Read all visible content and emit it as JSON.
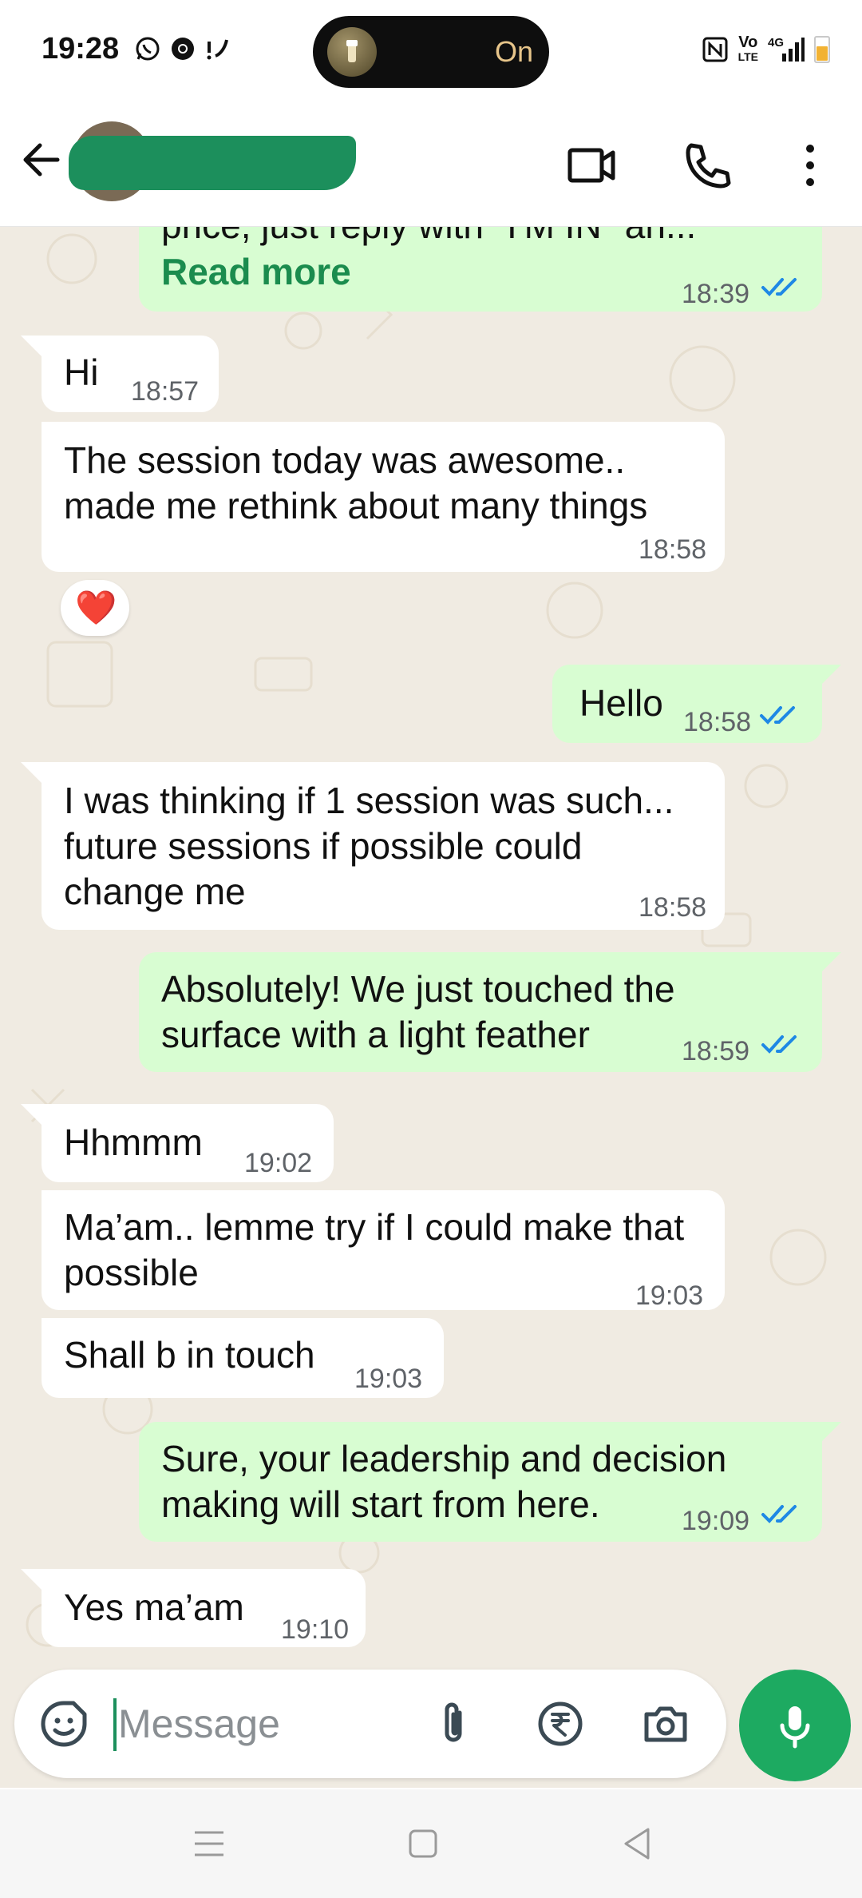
{
  "status_bar": {
    "time": "19:28",
    "island_label": "On",
    "network_volte": "Vo",
    "network_lte": "LTE",
    "network_type": "4G",
    "icons": [
      "whatsapp-icon",
      "chrome-icon",
      "missed-call-icon",
      "nfc-icon",
      "signal-icon",
      "battery-icon"
    ]
  },
  "header": {
    "icons": [
      "back-arrow-icon",
      "video-call-icon",
      "voice-call-icon",
      "more-vert-icon"
    ]
  },
  "messages": [
    {
      "dir": "out",
      "text": "price, just reply with \"I'M IN\" an...",
      "read_more": "Read more",
      "time": "18:39",
      "read": true
    },
    {
      "dir": "in",
      "text": "Hi",
      "time": "18:57"
    },
    {
      "dir": "in",
      "text": "The session today was awesome..\nmade me rethink about many things",
      "time": "18:58",
      "reaction": "❤️"
    },
    {
      "dir": "out",
      "text": "Hello",
      "time": "18:58",
      "read": true
    },
    {
      "dir": "in",
      "text": "I was thinking if 1 session was such...\nfuture sessions if possible could\nchange me",
      "time": "18:58"
    },
    {
      "dir": "out",
      "text": "Absolutely! We just touched the\nsurface with a light feather",
      "time": "18:59",
      "read": true
    },
    {
      "dir": "in",
      "text": "Hhmmm",
      "time": "19:02"
    },
    {
      "dir": "in",
      "text": "Ma’am.. lemme try if I could make that\npossible",
      "time": "19:03"
    },
    {
      "dir": "in",
      "text": "Shall b in touch",
      "time": "19:03"
    },
    {
      "dir": "out",
      "text": "Sure, your leadership and decision\nmaking will start from here.",
      "time": "19:09",
      "read": true
    },
    {
      "dir": "in",
      "text": "Yes ma’am",
      "time": "19:10"
    }
  ],
  "input": {
    "placeholder": "Message",
    "icons": [
      "sticker-icon",
      "attach-icon",
      "rupee-payment-icon",
      "camera-icon",
      "mic-icon"
    ]
  },
  "nav": {
    "icons": [
      "menu-icon",
      "home-icon",
      "back-icon"
    ]
  },
  "colors": {
    "outgoing_bubble": "#d8fdd2",
    "incoming_bubble": "#ffffff",
    "accent": "#1daa61",
    "chat_bg": "#f0ebe2",
    "read_ticks": "#1e88e5"
  }
}
